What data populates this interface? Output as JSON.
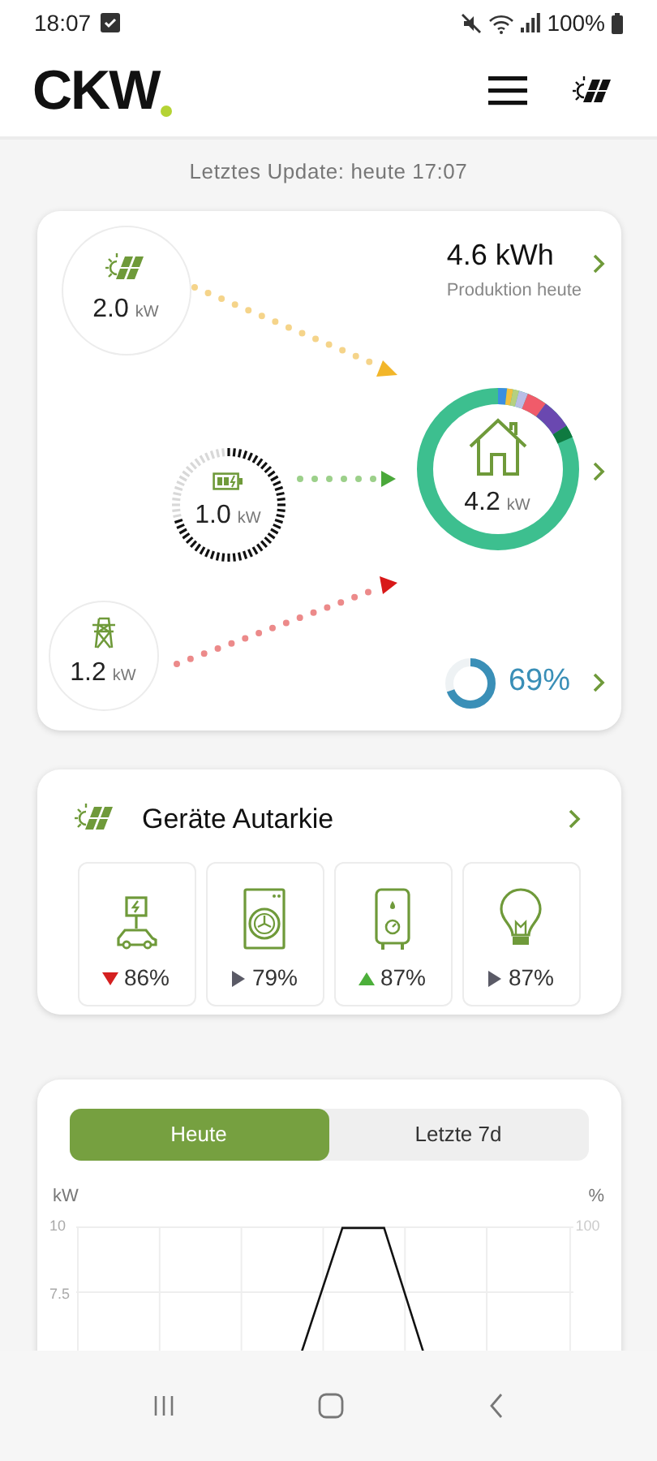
{
  "status_bar": {
    "time": "18:07",
    "battery": "100%"
  },
  "header": {
    "logo": "CKW"
  },
  "last_update": "Letztes Update: heute 17:07",
  "flow": {
    "solar": {
      "value": "2.0",
      "unit": "kW"
    },
    "production": {
      "value": "4.6 kWh",
      "label": "Produktion heute"
    },
    "battery": {
      "value": "1.0",
      "unit": "kW"
    },
    "house": {
      "value": "4.2",
      "unit": "kW"
    },
    "grid": {
      "value": "1.2",
      "unit": "kW"
    },
    "autarky": {
      "level": 0.69,
      "text": "69%"
    }
  },
  "devices": {
    "title": "Geräte Autarkie",
    "items": [
      {
        "kind": "ev-charger",
        "trend": {
          "kind": "down"
        },
        "value": "86%"
      },
      {
        "kind": "washer",
        "trend": {
          "kind": "flat"
        },
        "value": "79%"
      },
      {
        "kind": "boiler",
        "trend": {
          "kind": "up"
        },
        "value": "87%"
      },
      {
        "kind": "lamp",
        "trend": {
          "kind": "flat"
        },
        "value": "87%"
      }
    ]
  },
  "tabs": [
    {
      "label": "Heute",
      "selected": true
    },
    {
      "label": "Letzte 7d",
      "selected": false
    }
  ],
  "chart": {
    "y_unit": "kW",
    "y_ticks": [
      "10",
      "7.5"
    ],
    "y2_unit": "%",
    "y2_ticks": [
      "100"
    ]
  }
}
